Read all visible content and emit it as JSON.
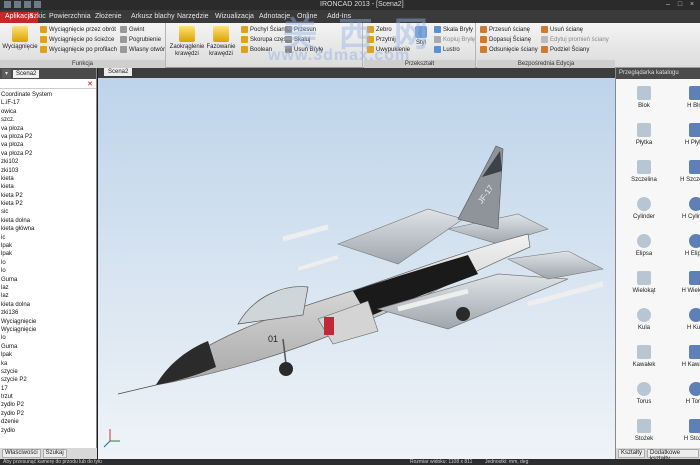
{
  "titlebar": {
    "title": "IRONCAD 2013 - [Scena2]"
  },
  "menu": {
    "tabs": [
      "Aplikacja",
      "Szkic",
      "Powierzchnia",
      "Złożenie",
      "Arkusz blachy",
      "Narzędzie",
      "Wizualizacja",
      "Adnotacje",
      "Online",
      "Add-Ins"
    ]
  },
  "ribbon": {
    "groups": {
      "funkcja": {
        "label": "Funkcja",
        "big": "Wyciągnięcie",
        "items": [
          "Wyciągnięcie przez obrót",
          "Wyciągnięcie po ścieżce",
          "Wyciągnięcie po profilach",
          "Gwint",
          "Pogrubienie",
          "Wlasny otwór"
        ]
      },
      "modyfikacja": {
        "label": "",
        "big1": "Zaokrąglenie krawędzi",
        "big2": "Fazowanie krawędzi",
        "items": [
          "Pochyl Ściany",
          "Skorupa części",
          "Boolean",
          "Przesun",
          "Skaluj",
          "Usuń Bryłę"
        ]
      },
      "przeksztalt": {
        "label": "Przekształt",
        "items": [
          "Zebro",
          "Przytnij",
          "Uwypuklenie",
          "Styl",
          "Skala Bryły",
          "Kopiuj Bryłę",
          "Lustro"
        ]
      },
      "edycja": {
        "label": "Bezpośrednia Edycja",
        "items": [
          "Przesuń ścianę",
          "Dopasuj Ścianę",
          "Odsunięcie ściany",
          "Usuń ścianę",
          "Edytuj promień ściany",
          "Podziel Ściany"
        ]
      }
    }
  },
  "left_panel": {
    "tab_label": "Scena2",
    "tree": [
      "Coordinate System",
      "L.iF-17",
      "owica",
      "szcz.",
      "va płoza",
      "va płoza P2",
      "va płoza",
      "va płoza P2",
      "zki102",
      "zki103",
      "kieta",
      "kieta",
      "kieta P2",
      "kieta P2",
      "sic",
      "kieta dolna",
      "kieta główna",
      "ic",
      "lpak",
      "lpak",
      "lo",
      "lo",
      "Guma",
      "laz",
      "laz",
      "kieta dolna",
      "zki136",
      "Wyciągnięcie",
      "Wyciągnięcie",
      "lo",
      "Guma",
      "lpak",
      "ka",
      "szycie",
      "szycie P2",
      "17",
      "trzut",
      "zydło P2",
      "zydło P2",
      "dzenie",
      "zydło"
    ],
    "bottom_tabs": [
      "Właściwości",
      "Szukaj"
    ]
  },
  "viewport": {
    "tab_label": "Scena2",
    "watermark_cn": "美 西 网",
    "watermark_url": "www.3dmax.com",
    "plane_marks": [
      "01",
      "JF-17"
    ]
  },
  "right_panel": {
    "title": "Przeglądarka katalogu",
    "items": [
      "Blok",
      "H Blok",
      "Płytka",
      "H Płytka",
      "Szczelina",
      "H Szczelina",
      "Cylinder",
      "H Cylinder",
      "Elipsa",
      "H Elipsa",
      "Wielokąt",
      "H Wielokąt",
      "Kula",
      "H Kula",
      "Kawałek",
      "H Kawałek",
      "Torus",
      "H Torus",
      "Stożek",
      "H Stożek"
    ],
    "bottom_tabs": [
      "Kształty",
      "Dodatkowe kształty"
    ]
  },
  "statusbar": {
    "left": "Aby przesunąć kamerę do przodu lub do tyłu",
    "size": "Rozmiar widoku: 1108 x 811",
    "units": "Jednostki: mm, deg"
  },
  "colors": {
    "accent": "#c62828",
    "ribbon_bg": "#e6e6e6",
    "sky_top": "#bcd3ea"
  }
}
